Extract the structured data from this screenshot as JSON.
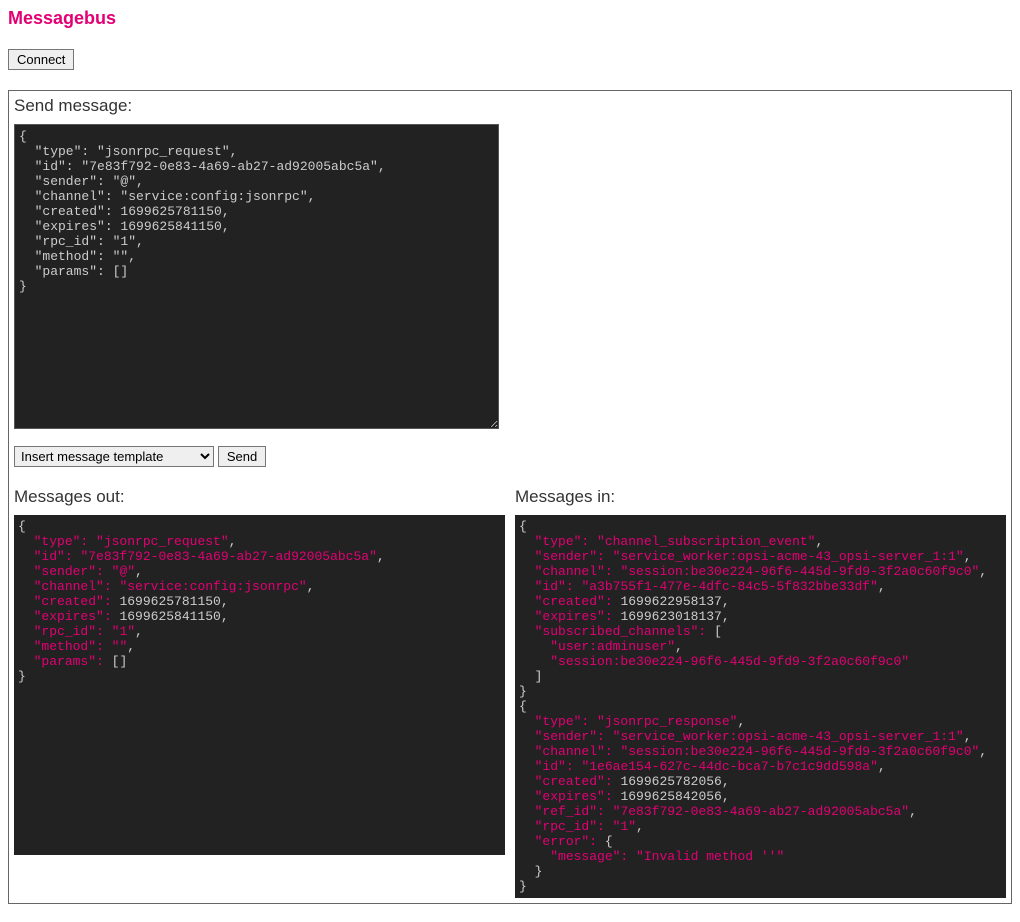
{
  "title": "Messagebus",
  "connect_label": "Connect",
  "panel_send_title": "Send message:",
  "template_select_label": "Insert message template",
  "send_button_label": "Send",
  "out_title": "Messages out:",
  "in_title": "Messages in:",
  "message_textarea": "{\n  \"type\": \"jsonrpc_request\",\n  \"id\": \"7e83f792-0e83-4a69-ab27-ad92005abc5a\",\n  \"sender\": \"@\",\n  \"channel\": \"service:config:jsonrpc\",\n  \"created\": 1699625781150,\n  \"expires\": 1699625841150,\n  \"rpc_id\": \"1\",\n  \"method\": \"\",\n  \"params\": []\n}",
  "messages_out": [
    {
      "type": "jsonrpc_request",
      "id": "7e83f792-0e83-4a69-ab27-ad92005abc5a",
      "sender": "@",
      "channel": "service:config:jsonrpc",
      "created": 1699625781150,
      "expires": 1699625841150,
      "rpc_id": "1",
      "method": "",
      "params": []
    }
  ],
  "messages_in": [
    {
      "type": "channel_subscription_event",
      "sender": "service_worker:opsi-acme-43_opsi-server_1:1",
      "channel": "session:be30e224-96f6-445d-9fd9-3f2a0c60f9c0",
      "id": "a3b755f1-477e-4dfc-84c5-5f832bbe33df",
      "created": 1699622958137,
      "expires": 1699623018137,
      "subscribed_channels": [
        "user:adminuser",
        "session:be30e224-96f6-445d-9fd9-3f2a0c60f9c0"
      ]
    },
    {
      "type": "jsonrpc_response",
      "sender": "service_worker:opsi-acme-43_opsi-server_1:1",
      "channel": "session:be30e224-96f6-445d-9fd9-3f2a0c60f9c0",
      "id": "1e6ae154-627c-44dc-bca7-b7c1c9dd598a",
      "created": 1699625782056,
      "expires": 1699625842056,
      "ref_id": "7e83f792-0e83-4a69-ab27-ad92005abc5a",
      "rpc_id": "1",
      "error": {
        "message": "Invalid method ''"
      }
    }
  ]
}
